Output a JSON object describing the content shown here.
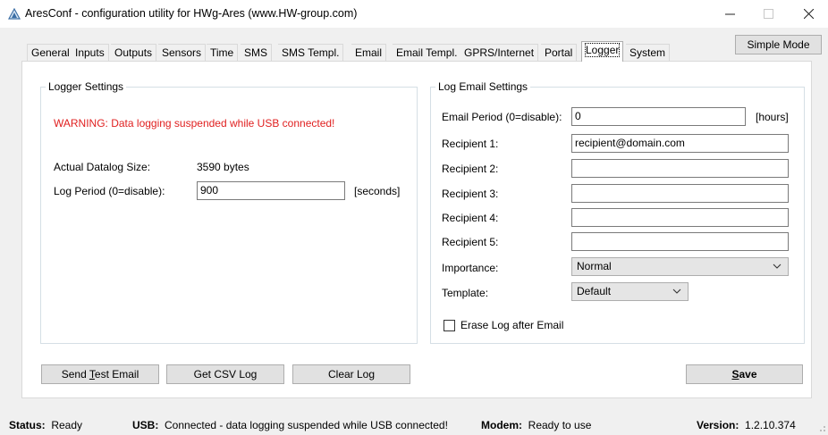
{
  "window": {
    "title": "AresConf - configuration utility for HWg-Ares (www.HW-group.com)",
    "minimize": "—",
    "maximize": "☐",
    "close": "✕"
  },
  "tabs": [
    "General",
    "Inputs",
    "Outputs",
    "Sensors",
    "Time",
    "SMS",
    "SMS Templ.",
    "Email",
    "Email Templ.",
    "GPRS/Internet",
    "Portal",
    "Logger",
    "System"
  ],
  "active_tab": "Logger",
  "simple_mode_button": "Simple Mode",
  "logger_settings": {
    "title": "Logger Settings",
    "warning": "WARNING: Data logging suspended while USB connected!",
    "datalog_size_label": "Actual Datalog Size:",
    "datalog_size_value": "3590 bytes",
    "log_period_label": "Log Period (0=disable):",
    "log_period_value": "900",
    "log_period_unit": "[seconds]"
  },
  "log_email_settings": {
    "title": "Log Email Settings",
    "email_period_label": "Email Period (0=disable):",
    "email_period_value": "0",
    "email_period_unit": "[hours]",
    "recipients": [
      {
        "label": "Recipient 1:",
        "value": "recipient@domain.com"
      },
      {
        "label": "Recipient 2:",
        "value": ""
      },
      {
        "label": "Recipient 3:",
        "value": ""
      },
      {
        "label": "Recipient 4:",
        "value": ""
      },
      {
        "label": "Recipient 5:",
        "value": ""
      }
    ],
    "importance_label": "Importance:",
    "importance_value": "Normal",
    "template_label": "Template:",
    "template_value": "Default",
    "erase_log_label": "Erase Log after Email",
    "erase_log_checked": false
  },
  "buttons": {
    "send_test_email_pre": "Send ",
    "send_test_email_key": "T",
    "send_test_email_post": "est Email",
    "get_csv_log": "Get CSV Log",
    "clear_log": "Clear Log",
    "save_key": "S",
    "save_post": "ave"
  },
  "status_bar": {
    "status_label": "Status:",
    "status_value": "Ready",
    "usb_label": "USB:",
    "usb_value": "Connected - data logging suspended while USB connected!",
    "modem_label": "Modem:",
    "modem_value": "Ready to use",
    "version_label": "Version:",
    "version_value": "1.2.10.374"
  },
  "colors": {
    "warning": "#e02020",
    "panel_bg": "#ffffff",
    "window_bg": "#f0f0f0"
  }
}
